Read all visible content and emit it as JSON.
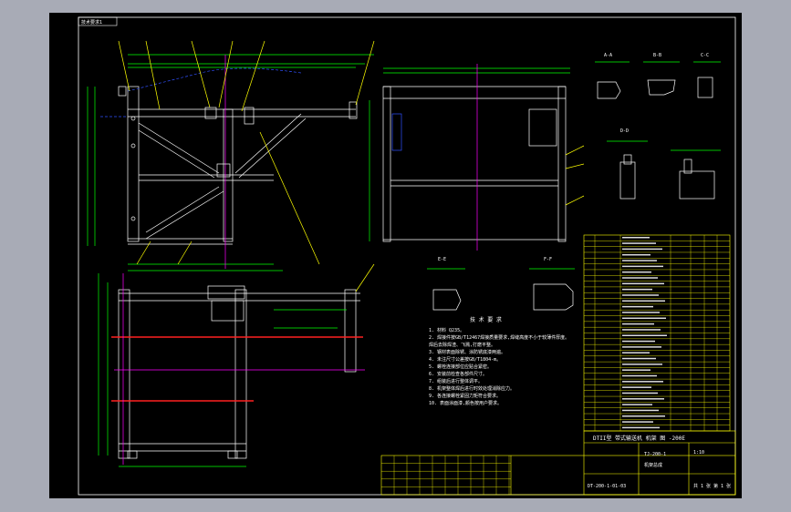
{
  "drawing": {
    "corner_tag": "技术要求1",
    "section_labels": [
      "A-A",
      "B-B",
      "C-C",
      "D-D",
      "E-E",
      "F-F"
    ],
    "tech_title": "技 术 要 求",
    "notes": [
      "1. 材料 Q235。",
      "2. 焊接件按GB/T12467焊接质量要求,焊缝高度不小于较薄件厚度。",
      "   焊后去除焊渣、飞溅,打磨平整。",
      "3. 钢材表面除锈、涂防锈底漆两遍。",
      "4. 未注尺寸公差按GB/T1804-m。",
      "5. 螺栓连接部位应贴合紧密。",
      "6. 安装前检查各部件尺寸。",
      "7. 组装后进行整体调平。",
      "8. 机架整体焊后进行时效处理消除应力。",
      "9. 各连接螺栓紧固力矩符合要求。",
      "10. 表面涂面漆,颜色按用户要求。"
    ],
    "title_block": {
      "main_title": "DTII型 带式输送机 机架 图 -200E",
      "drawing_no": "TJ-200-1",
      "scale": "1:10",
      "part_no": "DT-200-1-01-03",
      "label_a": "机架总成",
      "sheet": "共 1 张 第 1 张"
    }
  },
  "colors": {
    "sheet": "#000000",
    "frame": "#ffffff",
    "geometry": "#ffffff",
    "dimension": "#00ff00",
    "leader": "#ffff00",
    "centerline": "#ff00ff",
    "hidden": "#3050ff",
    "cut_line": "#ff2020",
    "table": "#ffff00"
  }
}
